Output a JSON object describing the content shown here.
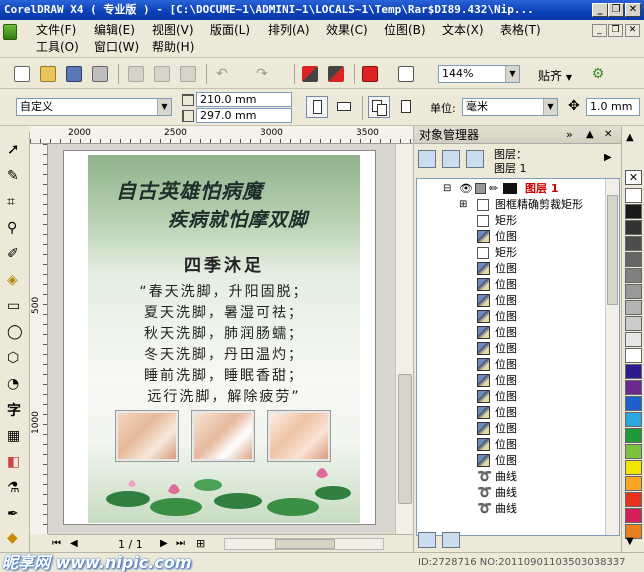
{
  "window": {
    "title": "CorelDRAW X4 ( 专业版 ) - [C:\\DOCUME~1\\ADMINI~1\\LOCALS~1\\Temp\\Rar$DI89.432\\Nip...",
    "minimize_glyph": "_",
    "restore_glyph": "❐",
    "close_glyph": "✕"
  },
  "menu": {
    "items": [
      "文件(F)",
      "编辑(E)",
      "视图(V)",
      "版面(L)",
      "排列(A)",
      "效果(C)",
      "位图(B)",
      "文本(X)",
      "表格(T)",
      "工具(O)",
      "窗口(W)",
      "帮助(H)"
    ]
  },
  "toolbar_standard": {
    "zoom_value": "144%",
    "snap_label": "贴齐"
  },
  "property_bar": {
    "paper_preset": "自定义",
    "width_value": "210.0 mm",
    "height_value": "297.0 mm",
    "units_label": "单位:",
    "units_value": "毫米",
    "nudge_value": "1.0 mm"
  },
  "ruler": {
    "h_labels": [
      "2000",
      "2500",
      "3000",
      "3500"
    ],
    "v_labels": [
      "500",
      "1000"
    ]
  },
  "artwork": {
    "calligraphy_line1": "自古英雄怕病魔",
    "calligraphy_line2": "疾病就怕摩双脚",
    "poem_title": "四季沐足",
    "poem_lines": [
      "“春天洗脚，升阳固脱；",
      "夏天洗脚，暑湿可祛；",
      "秋天洗脚，肺润肠蠕；",
      "冬天洗脚，丹田温灼；",
      "睡前洗脚，睡眠香甜；",
      "远行洗脚，解除疲劳”"
    ]
  },
  "object_manager": {
    "title": "对象管理器",
    "layer_header": "图层：",
    "layer_header_value": "图层 1",
    "layer_name": "图层 1",
    "rows": [
      {
        "type": "rect",
        "label": "图框精确剪裁矩形",
        "indent": 1
      },
      {
        "type": "rect",
        "label": "矩形",
        "indent": 2
      },
      {
        "type": "bitmap",
        "label": "位图",
        "indent": 2
      },
      {
        "type": "rect",
        "label": "矩形",
        "indent": 2
      },
      {
        "type": "bitmap",
        "label": "位图",
        "indent": 2
      },
      {
        "type": "bitmap",
        "label": "位图",
        "indent": 2
      },
      {
        "type": "bitmap",
        "label": "位图",
        "indent": 2
      },
      {
        "type": "bitmap",
        "label": "位图",
        "indent": 2
      },
      {
        "type": "bitmap",
        "label": "位图",
        "indent": 2
      },
      {
        "type": "bitmap",
        "label": "位图",
        "indent": 2
      },
      {
        "type": "bitmap",
        "label": "位图",
        "indent": 2
      },
      {
        "type": "bitmap",
        "label": "位图",
        "indent": 2
      },
      {
        "type": "bitmap",
        "label": "位图",
        "indent": 2
      },
      {
        "type": "bitmap",
        "label": "位图",
        "indent": 2
      },
      {
        "type": "bitmap",
        "label": "位图",
        "indent": 2
      },
      {
        "type": "bitmap",
        "label": "位图",
        "indent": 2
      },
      {
        "type": "bitmap",
        "label": "位图",
        "indent": 2
      },
      {
        "type": "curve",
        "label": "曲线",
        "indent": 2
      },
      {
        "type": "curve",
        "label": "曲线",
        "indent": 2
      },
      {
        "type": "curve",
        "label": "曲线",
        "indent": 2
      }
    ]
  },
  "palette": {
    "colors": [
      "#ffffff",
      "#1a1a1a",
      "#333333",
      "#4d4d4d",
      "#666666",
      "#808080",
      "#999999",
      "#b3b3b3",
      "#cccccc",
      "#e6e6e6",
      "#ffffff",
      "#2b1b8f",
      "#6b2a8f",
      "#1f5fcf",
      "#2ea7e0",
      "#1e9a3a",
      "#7cc242",
      "#f2e600",
      "#f5a623",
      "#e8321e",
      "#d61e5a",
      "#e97f1e"
    ]
  },
  "statusbar": {
    "page_indicator": "1 / 1",
    "watermark_text": "昵享网 www.nipic.com",
    "image_id": "ID:2728716 NO:20110901103503038337"
  }
}
